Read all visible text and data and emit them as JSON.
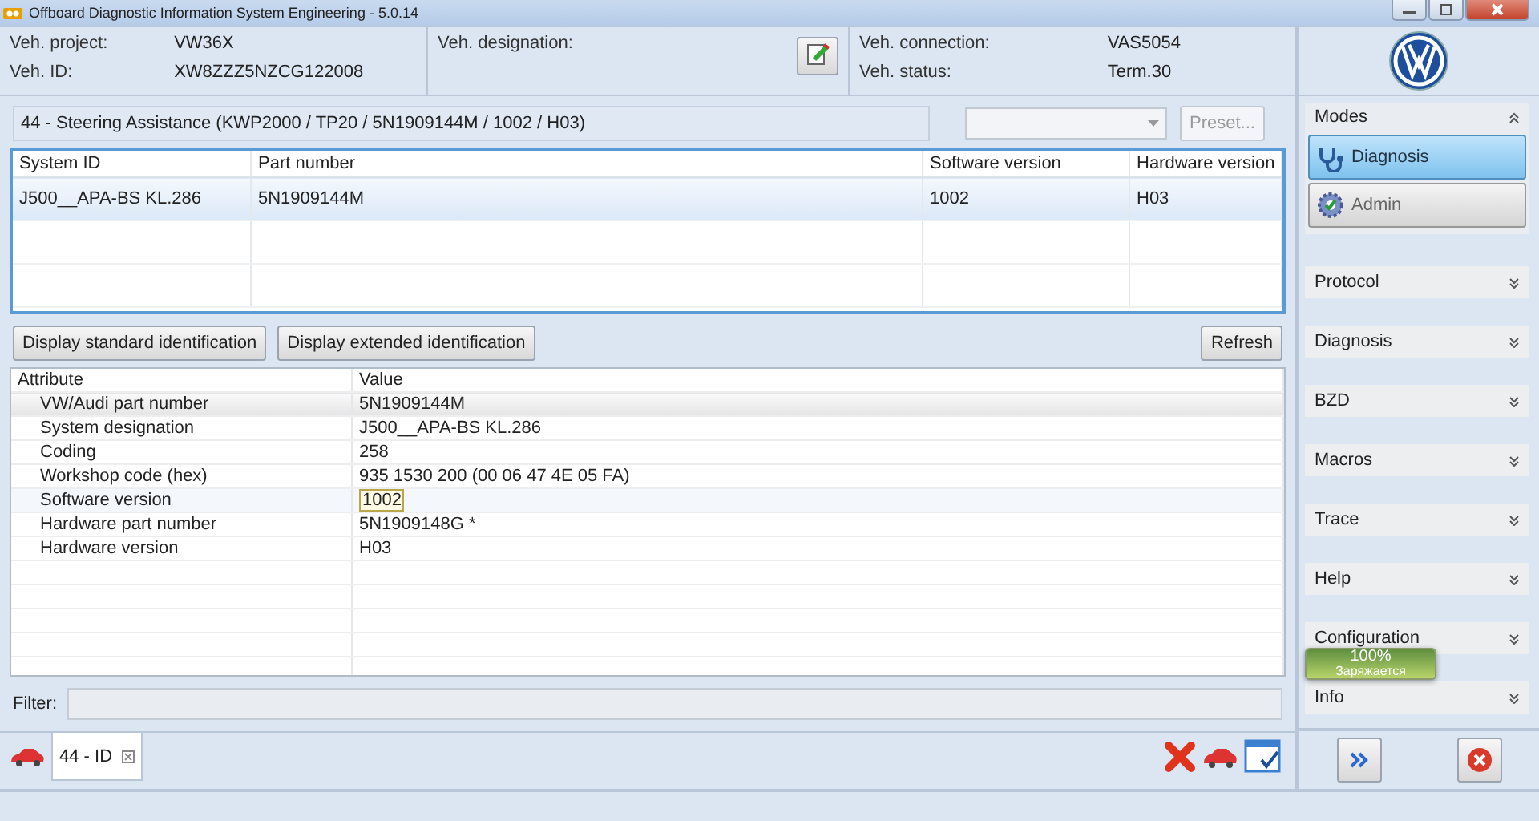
{
  "window": {
    "title": "Offboard Diagnostic Information System Engineering - 5.0.14"
  },
  "vehicle": {
    "fields": [
      {
        "label": "Veh. project:",
        "value": "VW36X"
      },
      {
        "label": "Veh. ID:",
        "value": "XW8ZZZ5NZCG122008"
      }
    ],
    "designation_label": "Veh. designation:",
    "connection": [
      {
        "label": "Veh. connection:",
        "value": "VAS5054"
      },
      {
        "label": "Veh. status:",
        "value": "Term.30"
      }
    ]
  },
  "control_unit": {
    "title": "44 - Steering Assistance  (KWP2000 / TP20 / 5N1909144M   / 1002 / H03)",
    "preset": {
      "label": "Preset...",
      "disabled": true
    }
  },
  "systems_table": {
    "columns": [
      "System ID",
      "Part number",
      "Software version",
      "Hardware version"
    ],
    "rows": [
      {
        "cells": [
          "J500__APA-BS KL.286",
          "5N1909144M",
          "1002",
          "H03"
        ],
        "selected": true
      }
    ]
  },
  "actions": [
    {
      "label": "Display standard identification"
    },
    {
      "label": "Display extended identification"
    },
    {
      "label": "Refresh"
    }
  ],
  "attributes_table": {
    "columns": [
      "Attribute",
      "Value"
    ],
    "rows": [
      {
        "attribute": "VW/Audi part number",
        "value": "5N1909144M",
        "selected": true,
        "focused": false
      },
      {
        "attribute": "System designation",
        "value": "J500__APA-BS KL.286",
        "selected": false,
        "focused": false
      },
      {
        "attribute": "Coding",
        "value": "258",
        "selected": false,
        "focused": false
      },
      {
        "attribute": "Workshop code (hex)",
        "value": "935 1530 200 (00 06 47 4E 05 FA)",
        "selected": false,
        "focused": false
      },
      {
        "attribute": "Software version",
        "value": "1002",
        "selected": false,
        "focused": true
      },
      {
        "attribute": "Hardware part number",
        "value": "5N1909148G  *",
        "selected": false,
        "focused": false
      },
      {
        "attribute": "Hardware version",
        "value": "H03",
        "selected": false,
        "focused": false
      }
    ]
  },
  "filter": {
    "label": "Filter:"
  },
  "tabs": [
    {
      "label": "44 - ID",
      "selected": true
    }
  ],
  "sidebar": {
    "modes_title": "Modes",
    "modes": [
      {
        "label": "Diagnosis",
        "selected": true
      },
      {
        "label": "Admin",
        "selected": false
      }
    ],
    "sections": [
      {
        "label": "Protocol"
      },
      {
        "label": "Diagnosis"
      },
      {
        "label": "BZD"
      },
      {
        "label": "Macros"
      },
      {
        "label": "Trace"
      },
      {
        "label": "Help"
      },
      {
        "label": "Configuration"
      },
      {
        "label": "Info"
      }
    ]
  },
  "battery": {
    "level": 1,
    "percent": "100%",
    "status": "Заряжается"
  }
}
